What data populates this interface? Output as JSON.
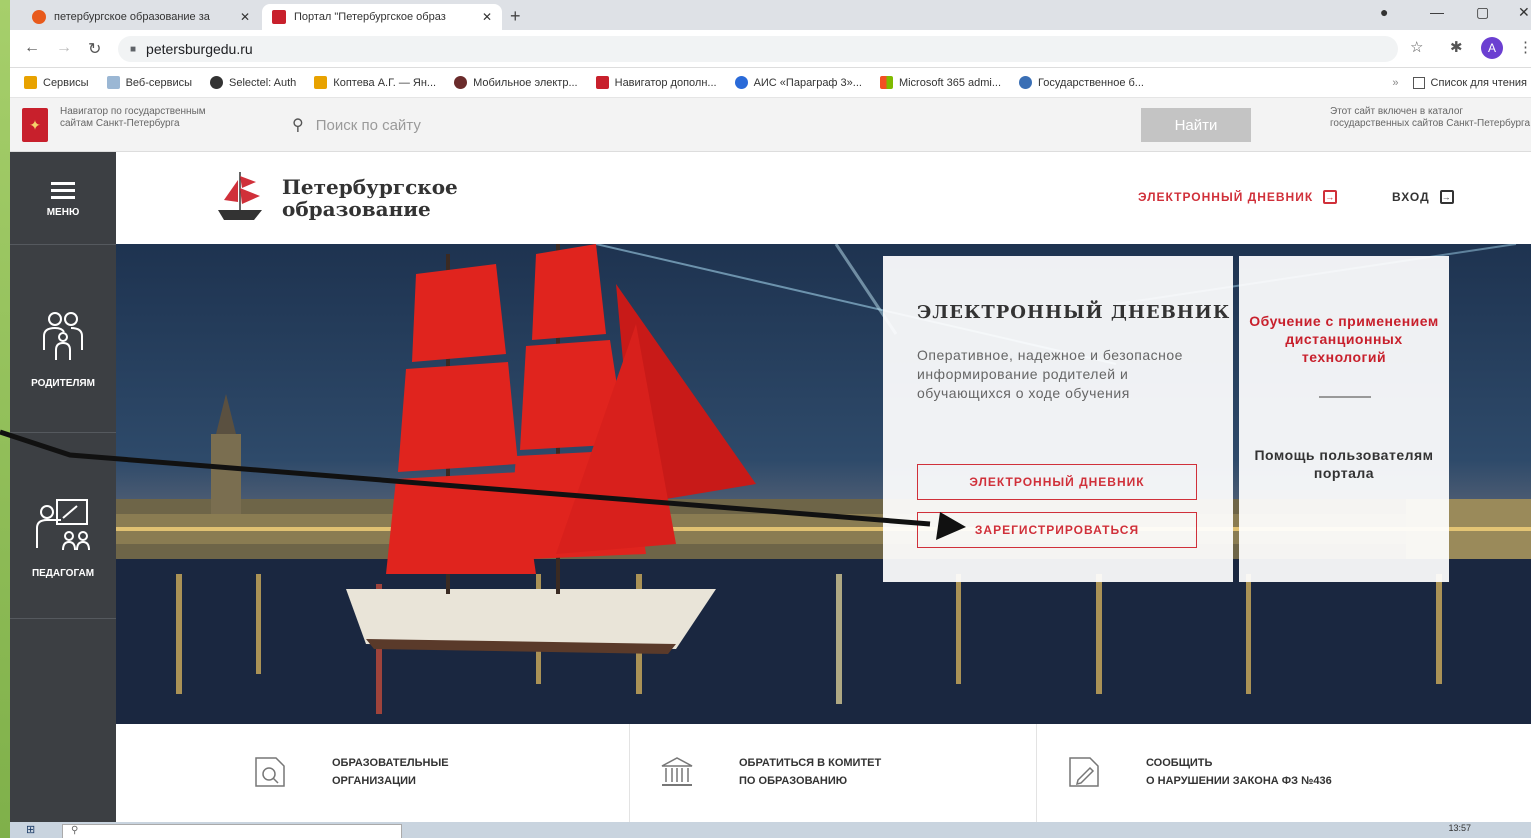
{
  "browser": {
    "tabs": [
      {
        "title": "петербургское образование за",
        "active": false
      },
      {
        "title": "Портал \"Петербургское образ",
        "active": true
      }
    ],
    "url": "petersburgedu.ru",
    "profile_letter": "A",
    "bookmarks": [
      {
        "label": "Сервисы",
        "color": "#e8a200"
      },
      {
        "label": "Веб-сервисы",
        "color": "#9bb7d4"
      },
      {
        "label": "Selectel: Auth",
        "color": "#333333"
      },
      {
        "label": "Коптева А.Г. — Ян...",
        "color": "#e8a200"
      },
      {
        "label": "Мобильное электр...",
        "color": "#6a2b2b"
      },
      {
        "label": "Навигатор дополн...",
        "color": "#c8202c"
      },
      {
        "label": "АИС «Параграф 3»...",
        "color": "#2a6ad8"
      },
      {
        "label": "Microsoft 365 admi...",
        "color": "#f25022"
      },
      {
        "label": "Государственное б...",
        "color": "#3a6fb5"
      }
    ],
    "reading_list": "Список для чтения"
  },
  "govbar": {
    "navigator_text": "Навигатор по государственным сайтам Санкт-Петербурга",
    "search_placeholder": "Поиск по сайту",
    "search_button": "Найти",
    "catalog_note": "Этот сайт включен в каталог государственных сайтов Санкт-Петербурга"
  },
  "sidebar": {
    "menu": "МЕНЮ",
    "parents": "РОДИТЕЛЯМ",
    "teachers": "ПЕДАГОГАМ"
  },
  "header": {
    "logo_line1": "Петербургское",
    "logo_line2": "образование",
    "diary_link": "ЭЛЕКТРОННЫЙ ДНЕВНИК",
    "login_link": "ВХОД"
  },
  "hero": {
    "card_title": "ЭЛЕКТРОННЫЙ ДНЕВНИК",
    "card_desc": "Оперативное, надежное и безопасное информирование родителей и обучающихся о ходе обучения",
    "diary_button": "ЭЛЕКТРОННЫЙ ДНЕВНИК",
    "register_button": "ЗАРЕГИСТРИРОВАТЬСЯ",
    "side_title": "Обучение с применением дистанционных технологий",
    "side_help": "Помощь пользователям портала"
  },
  "bottom_links": [
    {
      "line1": "ОБРАЗОВАТЕЛЬНЫЕ",
      "line2": "ОРГАНИЗАЦИИ",
      "icon": "search-doc-icon"
    },
    {
      "line1": "ОБРАТИТЬСЯ В КОМИТЕТ",
      "line2": "ПО ОБРАЗОВАНИЮ",
      "icon": "building-icon"
    },
    {
      "line1": "СООБЩИТЬ",
      "line2": "О НАРУШЕНИИ ЗАКОНА ФЗ №436",
      "icon": "edit-doc-icon"
    }
  ],
  "taskbar": {
    "time": "13:57"
  },
  "colors": {
    "accent_red": "#d0303a",
    "sidebar_dark": "#3c3f43",
    "slide_green": "#8fbf5a"
  }
}
